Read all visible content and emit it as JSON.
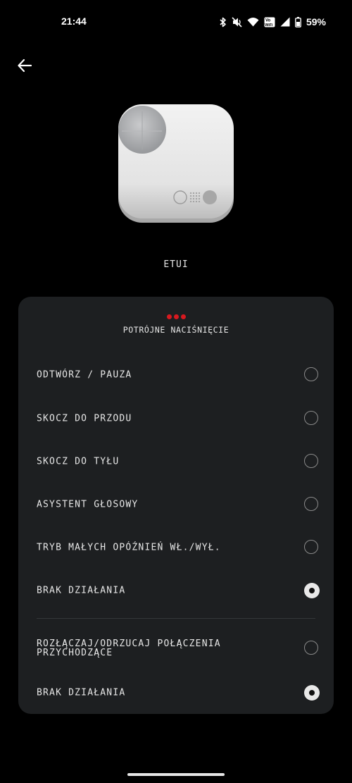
{
  "status_bar": {
    "time": "21:44",
    "battery_percent": "59%",
    "icons": [
      "bluetooth-icon",
      "mute-icon",
      "wifi-icon",
      "vowifi-icon",
      "signal-icon",
      "battery-icon"
    ],
    "vowifi_label_top": "Vo",
    "vowifi_label_bottom": "WiFi"
  },
  "header": {
    "back_icon": "arrow-left-icon"
  },
  "device": {
    "name": "ETUI",
    "image": "earbuds-case-image"
  },
  "panel": {
    "indicator_color": "#d7191f",
    "title": "POTRÓJNE NACIŚNIĘCIE",
    "music_options": [
      {
        "label": "ODTWÓRZ / PAUZA",
        "selected": false
      },
      {
        "label": "SKOCZ DO PRZODU",
        "selected": false
      },
      {
        "label": "SKOCZ DO TYŁU",
        "selected": false
      },
      {
        "label": "ASYSTENT GŁOSOWY",
        "selected": false
      },
      {
        "label": "TRYB MAŁYCH OPÓŹNIEŃ WŁ./WYŁ.",
        "selected": false
      },
      {
        "label": "BRAK DZIAŁANIA",
        "selected": true
      }
    ],
    "call_options": [
      {
        "label": "ROZŁĄCZAJ/ODRZUCAJ POŁĄCZENIA PRZYCHODZĄCE",
        "selected": false
      },
      {
        "label": "BRAK DZIAŁANIA",
        "selected": true
      }
    ]
  }
}
